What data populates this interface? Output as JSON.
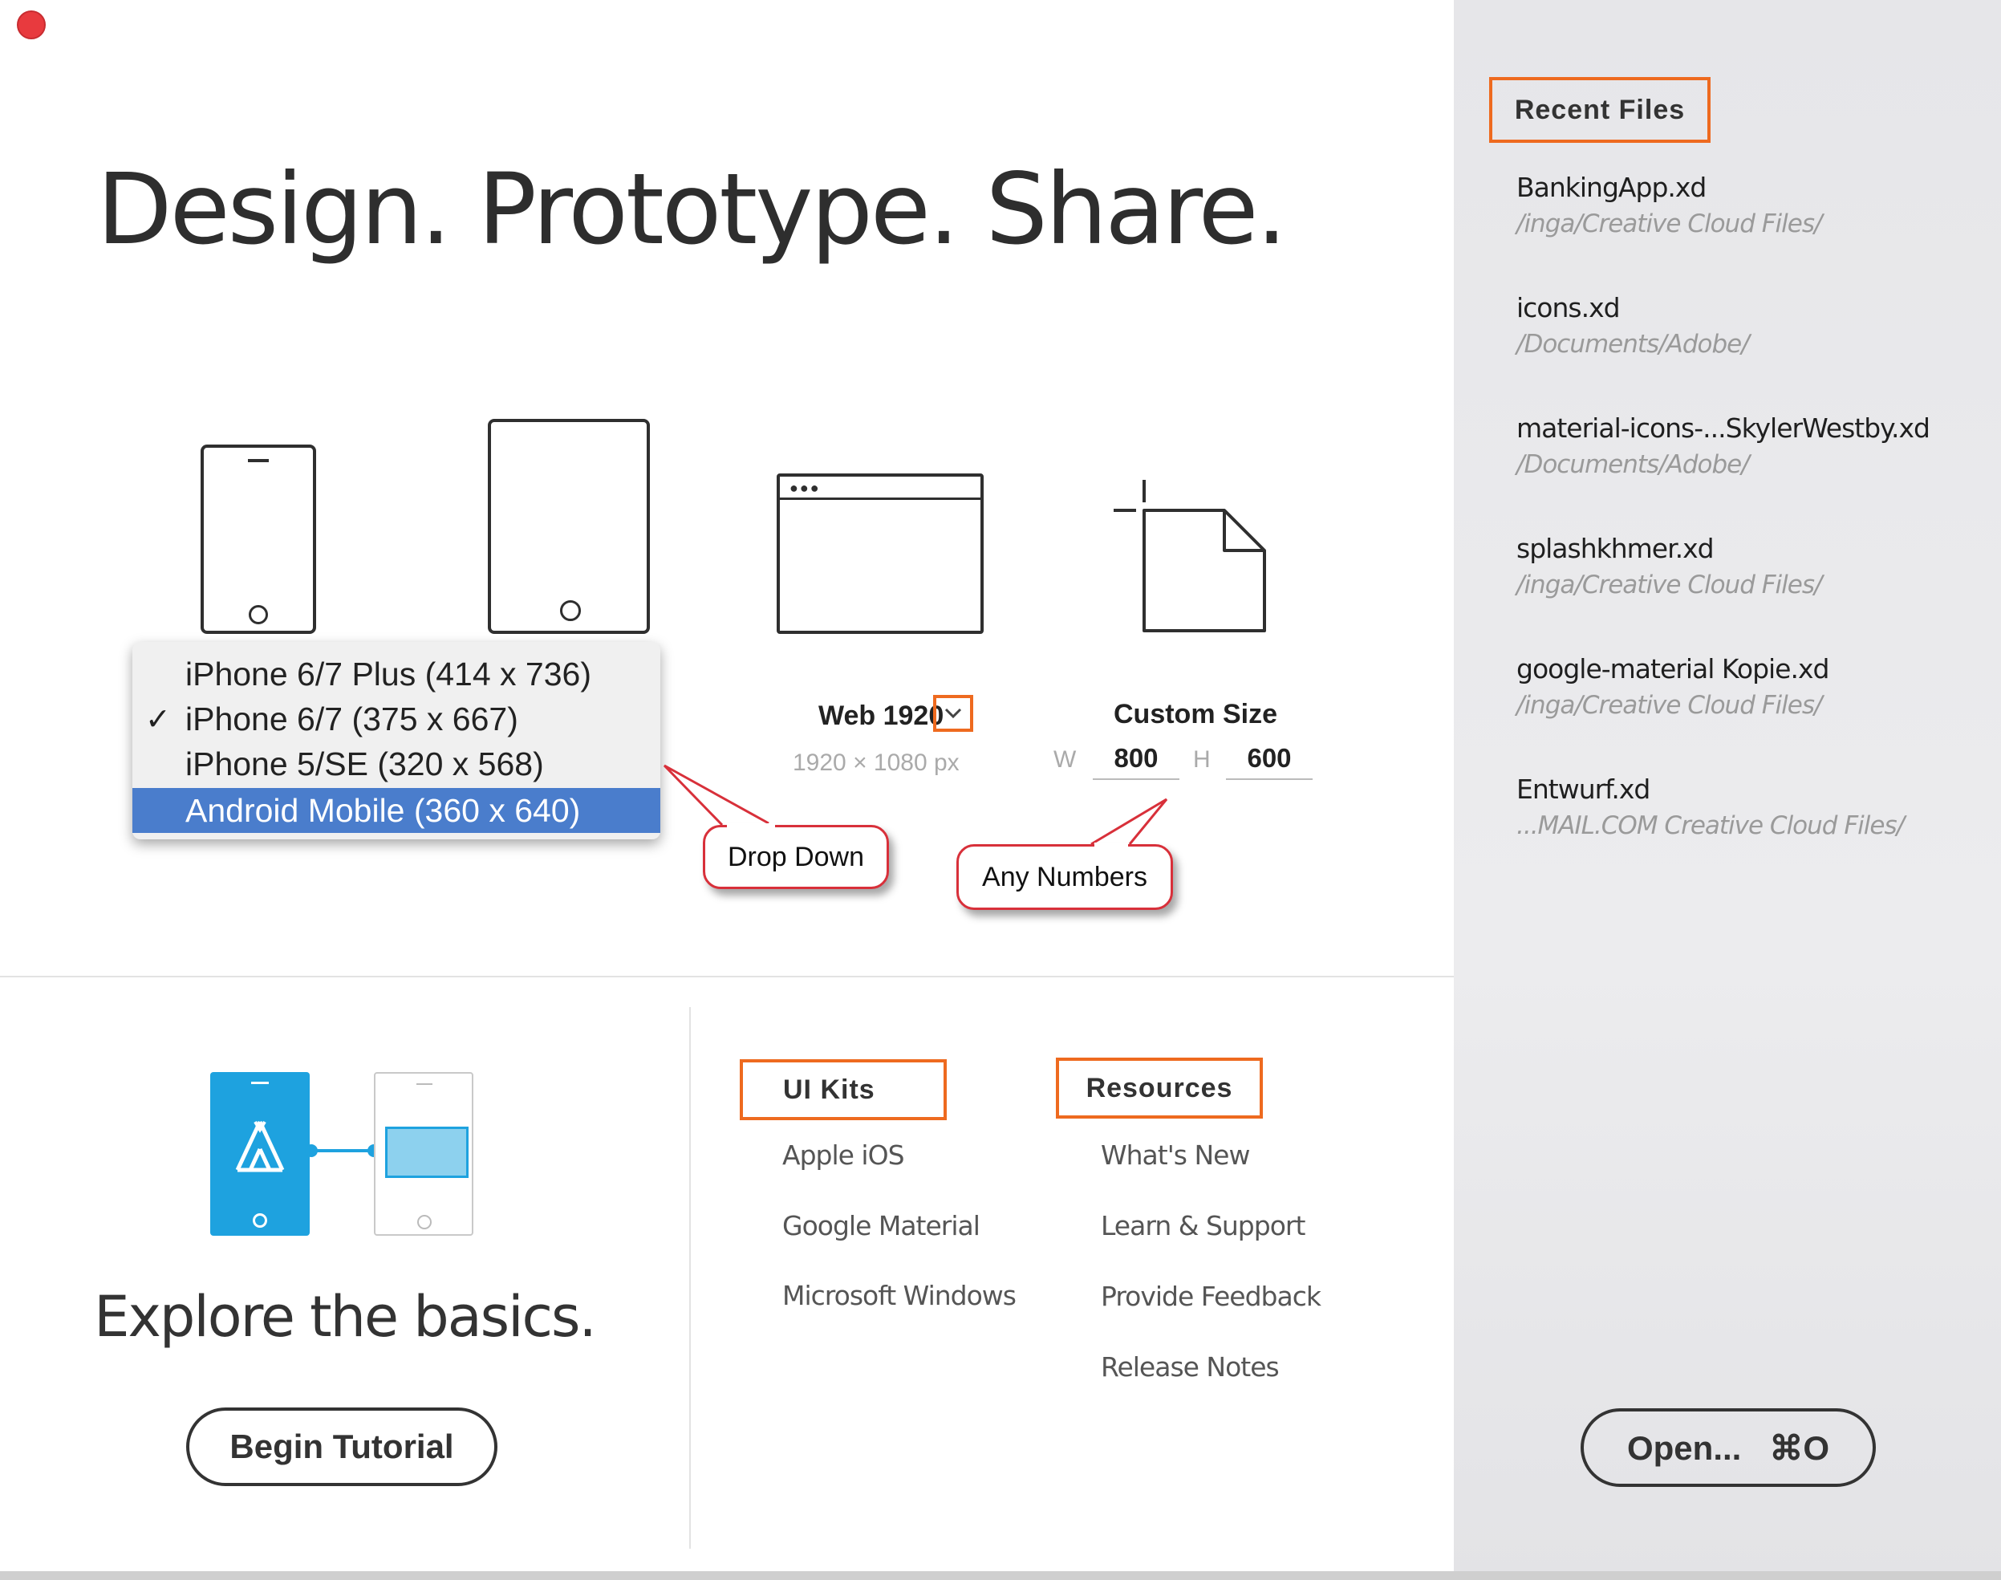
{
  "headline": "Design. Prototype. Share.",
  "presets": {
    "dropdown": {
      "items": [
        {
          "label": "iPhone 6/7 Plus (414 x 736)",
          "checked": false,
          "highlighted": false
        },
        {
          "label": "iPhone 6/7 (375 x 667)",
          "checked": true,
          "highlighted": false
        },
        {
          "label": "iPhone 5/SE (320 x 568)",
          "checked": false,
          "highlighted": false
        },
        {
          "label": "Android Mobile (360 x 640)",
          "checked": false,
          "highlighted": true
        }
      ],
      "check_glyph": "✓"
    },
    "web": {
      "label": "Web 1920",
      "size": "1920 × 1080 px"
    },
    "custom": {
      "label": "Custom Size",
      "w_label": "W",
      "w_value": "800",
      "h_label": "H",
      "h_value": "600"
    }
  },
  "callouts": {
    "drop_down": "Drop Down",
    "any_numbers": "Any Numbers"
  },
  "tutorial": {
    "text": "Explore the basics.",
    "button": "Begin Tutorial"
  },
  "ui_kits": {
    "header": "UI Kits",
    "links": [
      "Apple iOS",
      "Google Material",
      "Microsoft Windows"
    ]
  },
  "resources": {
    "header": "Resources",
    "links": [
      "What's New",
      "Learn & Support",
      "Provide Feedback",
      "Release Notes"
    ]
  },
  "recent": {
    "header": "Recent Files",
    "files": [
      {
        "name": "BankingApp.xd",
        "path": "/inga/Creative Cloud Files/"
      },
      {
        "name": "icons.xd",
        "path": "/Documents/Adobe/"
      },
      {
        "name": "material-icons-...SkylerWestby.xd",
        "path": "/Documents/Adobe/"
      },
      {
        "name": "splashkhmer.xd",
        "path": "/inga/Creative Cloud Files/"
      },
      {
        "name": "google-material Kopie.xd",
        "path": "/inga/Creative Cloud Files/"
      },
      {
        "name": "Entwurf.xd",
        "path": "...MAIL.COM Creative Cloud Files/"
      }
    ],
    "open_button": "Open...   ⌘O"
  },
  "colors": {
    "accent_orange": "#ee6a1f",
    "selection_blue": "#4a7dcc",
    "callout_red": "#d8303a",
    "close_red": "#e83a3e",
    "tutorial_blue": "#1ea2df"
  }
}
